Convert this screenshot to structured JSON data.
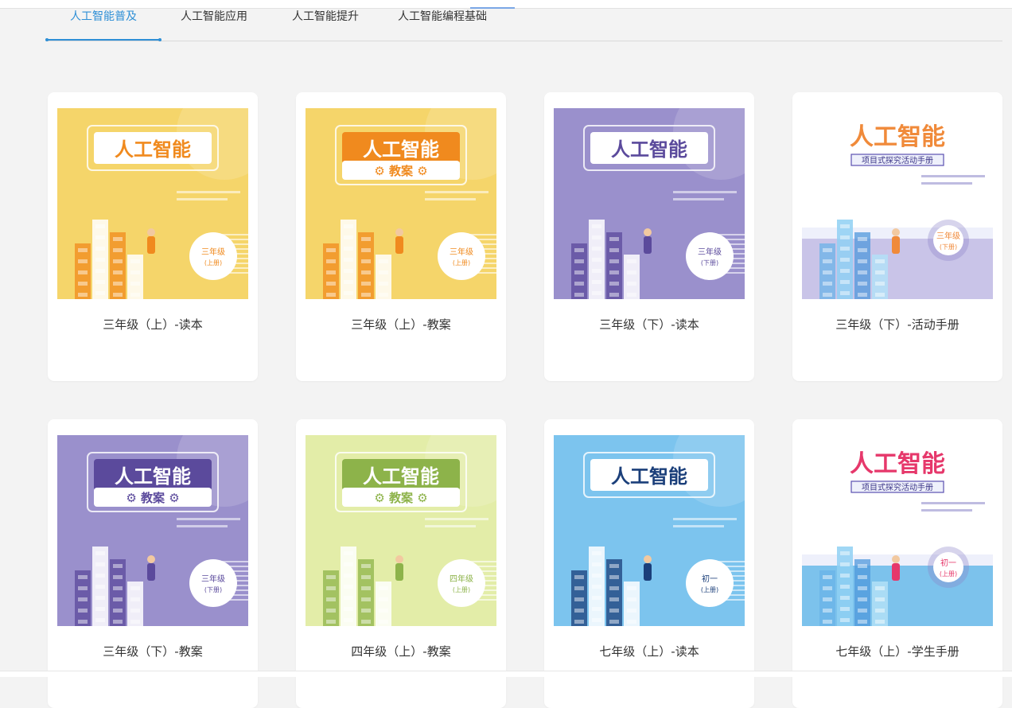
{
  "tabs": [
    {
      "label": "人工智能普及",
      "active": true
    },
    {
      "label": "人工智能应用",
      "active": false
    },
    {
      "label": "人工智能提升",
      "active": false
    },
    {
      "label": "人工智能编程基础",
      "active": false
    }
  ],
  "cover_title": "人工智能",
  "books": [
    {
      "caption": "三年级（上）-读本",
      "theme": "#f5d56a",
      "accent": "#f08a1e",
      "badge_line1": "三年级",
      "badge_line2": "(上册)",
      "subtitle": ""
    },
    {
      "caption": "三年级（上）-教案",
      "theme": "#f5d56a",
      "accent": "#f08a1e",
      "badge_line1": "三年级",
      "badge_line2": "(上册)",
      "subtitle": "教案"
    },
    {
      "caption": "三年级（下）-读本",
      "theme": "#9a90cc",
      "accent": "#5b4a9c",
      "badge_line1": "三年级",
      "badge_line2": "(下册)",
      "subtitle": ""
    },
    {
      "caption": "三年级（下）-活动手册",
      "theme": "#ffffff",
      "accent": "#f08a3a",
      "badge_line1": "三年级",
      "badge_line2": "(下册)",
      "subtitle": "项目式探究活动手册"
    },
    {
      "caption": "三年级（下）-教案",
      "theme": "#9a90cc",
      "accent": "#5b4a9c",
      "badge_line1": "三年级",
      "badge_line2": "(下册)",
      "subtitle": "教案"
    },
    {
      "caption": "四年级（上）-教案",
      "theme": "#e3eda8",
      "accent": "#8db34a",
      "badge_line1": "四年级",
      "badge_line2": "(上册)",
      "subtitle": "教案"
    },
    {
      "caption": "七年级（上）-读本",
      "theme": "#7cc4ee",
      "accent": "#1b3f7a",
      "badge_line1": "初一",
      "badge_line2": "(上册)",
      "subtitle": ""
    },
    {
      "caption": "七年级（上）-学生手册",
      "theme": "#ffffff",
      "accent": "#e6386b",
      "badge_line1": "初一",
      "badge_line2": "(上册)",
      "subtitle": "项目式探究活动手册"
    }
  ]
}
